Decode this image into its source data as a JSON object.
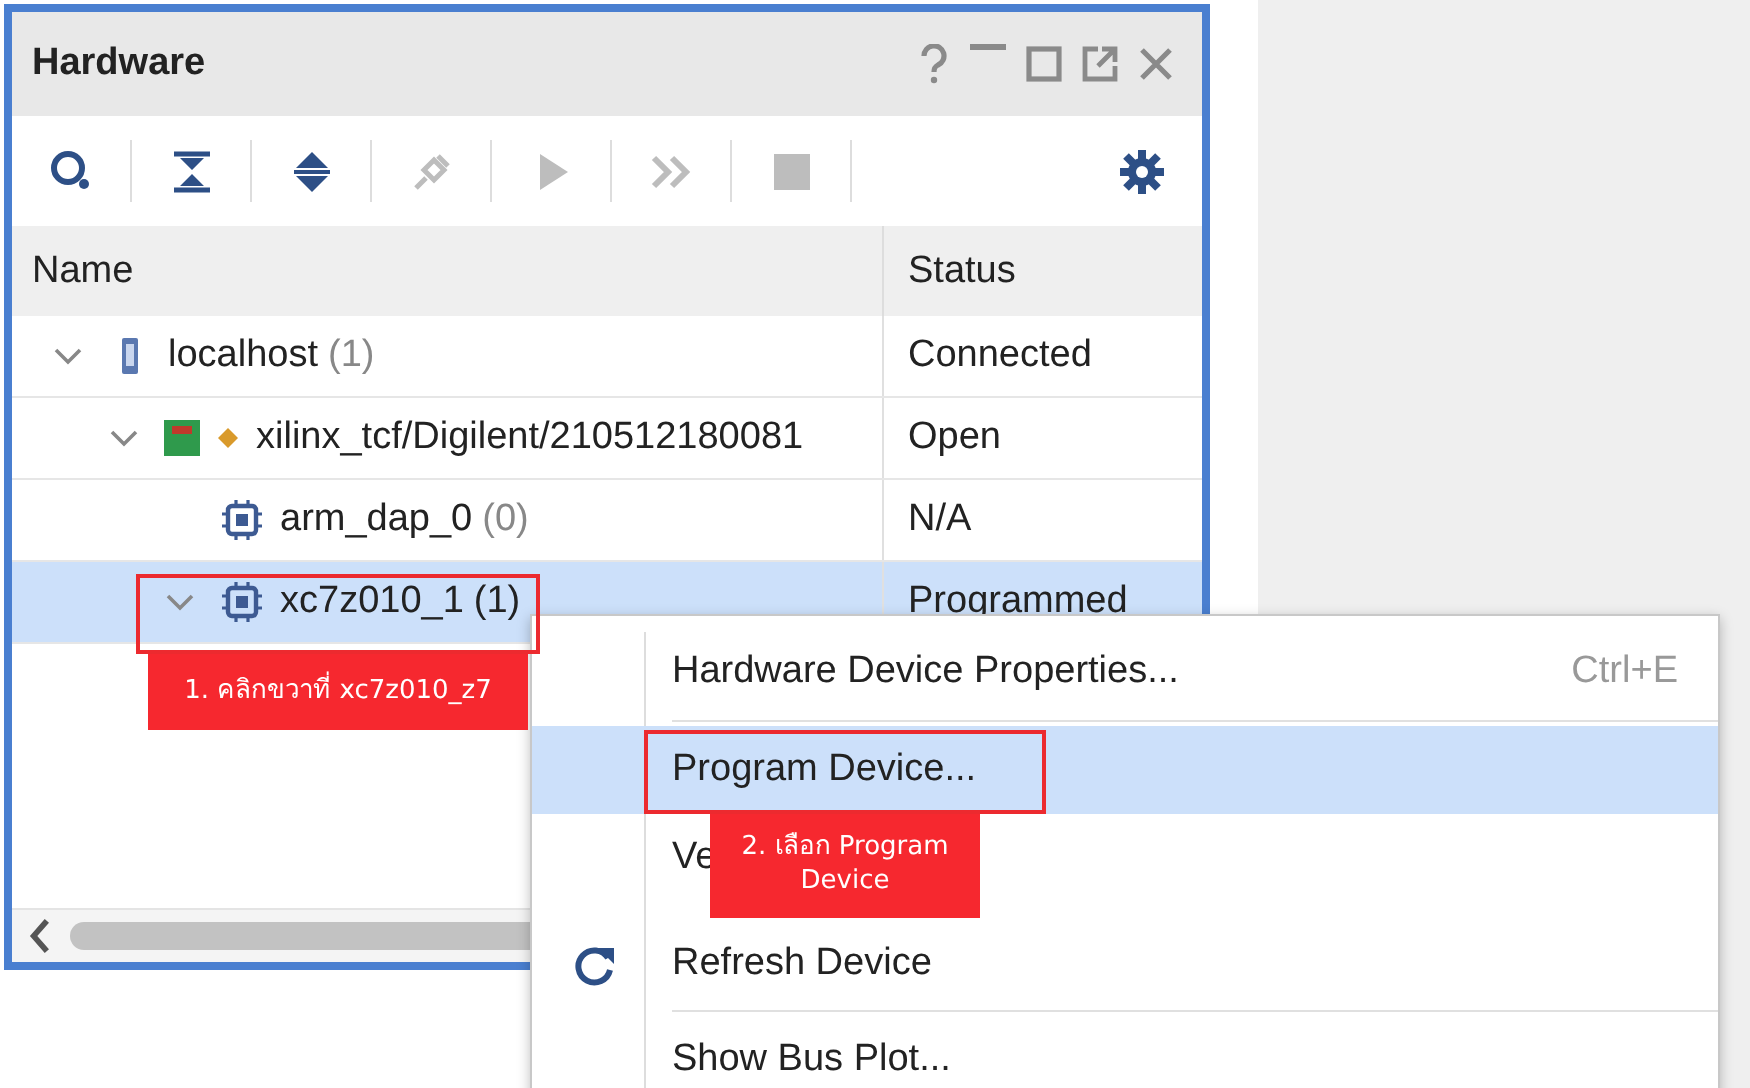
{
  "panel": {
    "title": "Hardware"
  },
  "toolbar": [
    {
      "kind": "search",
      "disabled": false
    },
    {
      "kind": "collapse",
      "disabled": false
    },
    {
      "kind": "expand",
      "disabled": false
    },
    {
      "kind": "connect",
      "disabled": true
    },
    {
      "kind": "run",
      "disabled": true
    },
    {
      "kind": "run-all",
      "disabled": true
    },
    {
      "kind": "stop",
      "disabled": true
    },
    {
      "kind": "settings",
      "disabled": false
    }
  ],
  "columns": [
    "Name",
    "Status"
  ],
  "tree": [
    {
      "kind": "server",
      "name": "localhost",
      "count": "(1)",
      "status": "Connected",
      "expanded": true,
      "selected": false,
      "children": [
        {
          "kind": "board",
          "name": "xilinx_tcf/Digilent/210512180081",
          "status": "Open",
          "expanded": true,
          "selected": false,
          "children": [
            {
              "kind": "chip",
              "name": "arm_dap_0",
              "count": "(0)",
              "status": "N/A",
              "selected": false
            },
            {
              "kind": "chip",
              "name": "xc7z010_1",
              "count": "(1)",
              "status": "Programmed",
              "expanded": true,
              "selected": true
            }
          ]
        }
      ]
    }
  ],
  "context_menu": {
    "items": [
      {
        "kind": "item",
        "label": "Hardware Device Properties...",
        "shortcut": "Ctrl+E",
        "selected": false
      },
      {
        "kind": "separator"
      },
      {
        "kind": "item",
        "label": "Program Device...",
        "selected": true
      },
      {
        "kind": "item",
        "label": "Ve",
        "selected": false
      },
      {
        "kind": "refresh-item",
        "label": "Refresh Device",
        "selected": false
      },
      {
        "kind": "separator"
      },
      {
        "kind": "item",
        "label": "Show Bus Plot...",
        "selected": false
      }
    ]
  },
  "annotations": [
    {
      "text": "1. คลิกขวาที่ xc7z010_z7"
    },
    {
      "text": "2. เลือก Program Device"
    }
  ]
}
